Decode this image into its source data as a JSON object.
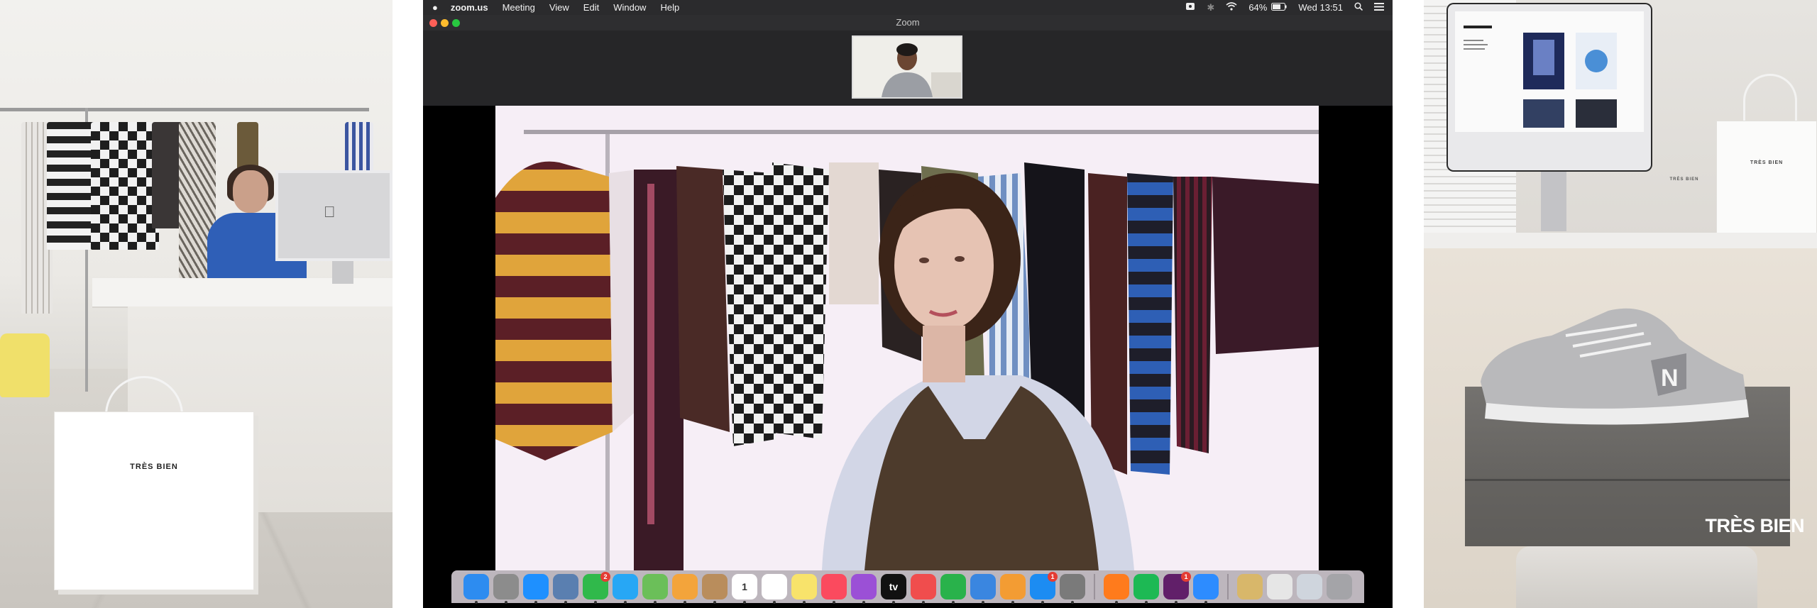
{
  "left_photo": {
    "bag_label": "TRÈS BIEN"
  },
  "menubar": {
    "apple_icon": "apple-logo",
    "app_name": "zoom.us",
    "menus": [
      "Meeting",
      "View",
      "Edit",
      "Window",
      "Help"
    ],
    "status": {
      "battery_percent": "64%",
      "clock": "Wed 13:51"
    }
  },
  "zoom_window": {
    "title": "Zoom"
  },
  "dock": {
    "apps": [
      {
        "name": "Finder",
        "icon": "finder-icon",
        "color": "#2d8cf0"
      },
      {
        "name": "Launchpad",
        "icon": "rocket-icon",
        "color": "#8c8c8c"
      },
      {
        "name": "Safari",
        "icon": "compass-icon",
        "color": "#1e90ff"
      },
      {
        "name": "Preview",
        "icon": "preview-icon",
        "color": "#5a7fb0"
      },
      {
        "name": "FaceTime",
        "icon": "video-camera-icon",
        "color": "#30b94b",
        "badge": "2"
      },
      {
        "name": "Messages",
        "icon": "chat-bubble-icon",
        "color": "#27a7f5"
      },
      {
        "name": "Maps",
        "icon": "map-icon",
        "color": "#6bbf59"
      },
      {
        "name": "Photos",
        "icon": "photos-flower-icon",
        "color": "#f3a43b"
      },
      {
        "name": "Contacts",
        "icon": "contacts-book-icon",
        "color": "#b98d5c"
      },
      {
        "name": "Calendar",
        "icon": "calendar-icon",
        "color": "#ffffff",
        "text": "1"
      },
      {
        "name": "Reminders",
        "icon": "list-icon",
        "color": "#ffffff"
      },
      {
        "name": "Notes",
        "icon": "notes-icon",
        "color": "#f8e36b"
      },
      {
        "name": "Music",
        "icon": "music-note-icon",
        "color": "#fb4a5e"
      },
      {
        "name": "Podcasts",
        "icon": "podcast-icon",
        "color": "#9b50d6"
      },
      {
        "name": "TV",
        "icon": "apple-tv-icon",
        "color": "#111111",
        "text": "tv"
      },
      {
        "name": "News",
        "icon": "news-icon",
        "color": "#f04d4d"
      },
      {
        "name": "Numbers",
        "icon": "bar-chart-icon",
        "color": "#29b24b"
      },
      {
        "name": "Keynote",
        "icon": "podium-icon",
        "color": "#3a86e0"
      },
      {
        "name": "Pages",
        "icon": "pen-icon",
        "color": "#f39c33"
      },
      {
        "name": "App Store",
        "icon": "app-store-icon",
        "color": "#1c8cf2",
        "badge": "1"
      },
      {
        "name": "System Preferences",
        "icon": "gear-icon",
        "color": "#7a7a7a"
      },
      {
        "name": "Firefox",
        "icon": "firefox-icon",
        "color": "#ff7b1c"
      },
      {
        "name": "Spotify",
        "icon": "spotify-icon",
        "color": "#1db954"
      },
      {
        "name": "Slack",
        "icon": "slack-icon",
        "color": "#611f69",
        "badge": "1"
      },
      {
        "name": "Zoom",
        "icon": "zoom-camera-icon",
        "color": "#2d8cff"
      },
      {
        "name": "Downloads stack",
        "icon": "stack-icon",
        "color": "#d8b76a"
      },
      {
        "name": "Documents stack",
        "icon": "document-stack-icon",
        "color": "#e6e6e6"
      },
      {
        "name": "Screenshots stack",
        "icon": "screenshot-stack-icon",
        "color": "#cfd5dd"
      },
      {
        "name": "Trash",
        "icon": "trash-icon",
        "color": "#a4a4a8"
      }
    ]
  },
  "right_photo": {
    "bag_label": "TRÈS BIEN",
    "box_label": "TRÈS BIEN",
    "brand_logo": "TRÈS BIEN",
    "shoe_logo": "N"
  }
}
